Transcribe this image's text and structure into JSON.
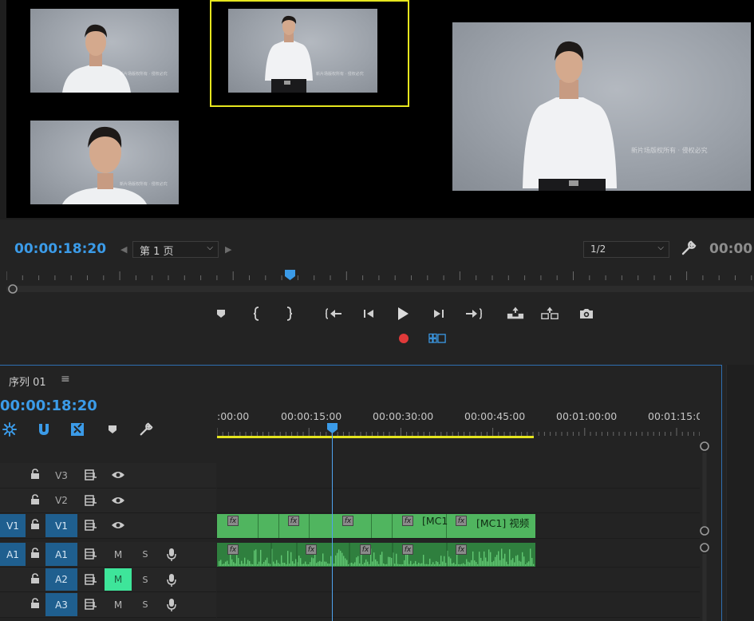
{
  "monitor": {
    "watermark": "新片场版权所有 · 侵权必究",
    "timecode": "00:00:18:20",
    "page_select": "第 1 页",
    "resolution_select": "1/2",
    "duration": "00:00:"
  },
  "timeline": {
    "sequence_name": "序列 01",
    "menu_glyph": "≡",
    "timecode": "00:00:18:20",
    "ruler_labels": [
      ":00:00",
      "00:00:15:00",
      "00:00:30:00",
      "00:00:45:00",
      "00:01:00:00",
      "00:01:15:0"
    ],
    "tracks": {
      "v3": {
        "target": "V3"
      },
      "v2": {
        "target": "V2"
      },
      "v1": {
        "source": "V1",
        "target": "V1"
      },
      "a1": {
        "source": "A1",
        "target": "A1",
        "mute": "M",
        "solo": "S"
      },
      "a2": {
        "target": "A2",
        "mute": "M",
        "solo": "S"
      },
      "a3": {
        "target": "A3",
        "mute": "M",
        "solo": "S"
      }
    },
    "fx_label": "fx",
    "clip_labels": [
      "[MC1",
      "[MC1] 视频"
    ]
  },
  "colors": {
    "accent_blue": "#3b9be8",
    "active_camera_border": "#e6e61e",
    "video_clip": "#50b55f",
    "audio_clip": "#2f7f3e",
    "record": "#e03a3a",
    "mute_on": "#3ee59a"
  }
}
